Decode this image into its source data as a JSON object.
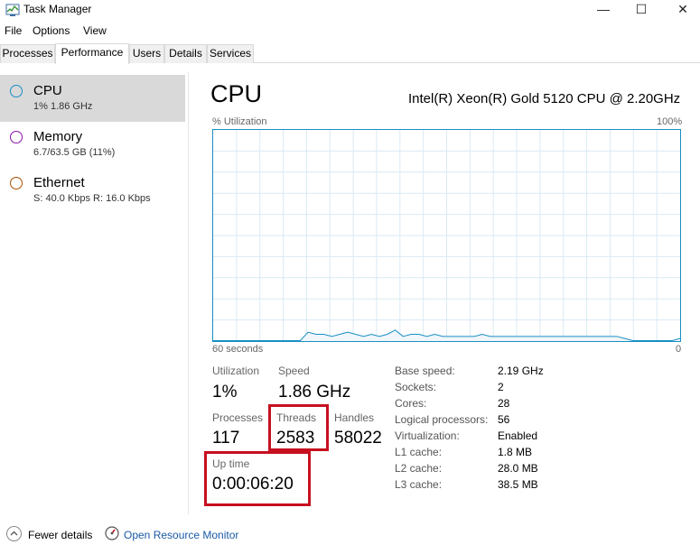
{
  "window": {
    "title": "Task Manager",
    "controls": {
      "minimize": "—",
      "maximize": "☐",
      "close": "✕"
    }
  },
  "menu": [
    "File",
    "Options",
    "View"
  ],
  "tabs": [
    "Processes",
    "Performance",
    "Users",
    "Details",
    "Services"
  ],
  "active_tab": "Performance",
  "sidebar": [
    {
      "title": "CPU",
      "subtitle": "1% 1.86 GHz",
      "color": "#1a8fc4",
      "selected": true
    },
    {
      "title": "Memory",
      "subtitle": "6.7/63.5 GB (11%)",
      "color": "#8b12ae",
      "selected": false
    },
    {
      "title": "Ethernet",
      "subtitle": "S: 40.0 Kbps R: 16.0 Kbps",
      "color": "#a74f01",
      "selected": false
    }
  ],
  "main": {
    "title": "CPU",
    "model": "Intel(R) Xeon(R) Gold 5120 CPU @ 2.20GHz",
    "graph": {
      "y_label": "% Utilization",
      "y_max_label": "100%",
      "x_left_label": "60 seconds",
      "x_right_label": "0",
      "line_color": "#1a8fc4",
      "grid_color": "#d9eaf4",
      "points": [
        0,
        0,
        0,
        0,
        0,
        0,
        0,
        0,
        0,
        0,
        0,
        0,
        4,
        3,
        3,
        2,
        3,
        4,
        3,
        2,
        3,
        2,
        3,
        5,
        2,
        3,
        3,
        2,
        3,
        2,
        2,
        2,
        2,
        2,
        3,
        2,
        2,
        2,
        2,
        2,
        2,
        2,
        2,
        2,
        2,
        2,
        2,
        2,
        2,
        2,
        2,
        2,
        1,
        0,
        0,
        0,
        0,
        0,
        0,
        1
      ]
    },
    "stats": {
      "utilization": {
        "label": "Utilization",
        "value": "1%"
      },
      "speed": {
        "label": "Speed",
        "value": "1.86 GHz"
      },
      "processes": {
        "label": "Processes",
        "value": "117"
      },
      "threads": {
        "label": "Threads",
        "value": "2583"
      },
      "handles": {
        "label": "Handles",
        "value": "58022"
      },
      "uptime": {
        "label": "Up time",
        "value": "0:00:06:20"
      }
    },
    "info": [
      {
        "label": "Base speed:",
        "value": "2.19 GHz"
      },
      {
        "label": "Sockets:",
        "value": "2"
      },
      {
        "label": "Cores:",
        "value": "28"
      },
      {
        "label": "Logical processors:",
        "value": "56"
      },
      {
        "label": "Virtualization:",
        "value": "Enabled"
      },
      {
        "label": "L1 cache:",
        "value": "1.8 MB"
      },
      {
        "label": "L2 cache:",
        "value": "28.0 MB"
      },
      {
        "label": "L3 cache:",
        "value": "38.5 MB"
      }
    ]
  },
  "footer": {
    "fewer_details": "Fewer details",
    "open_resource_monitor": "Open Resource Monitor"
  },
  "highlight_color": "#c7101f"
}
